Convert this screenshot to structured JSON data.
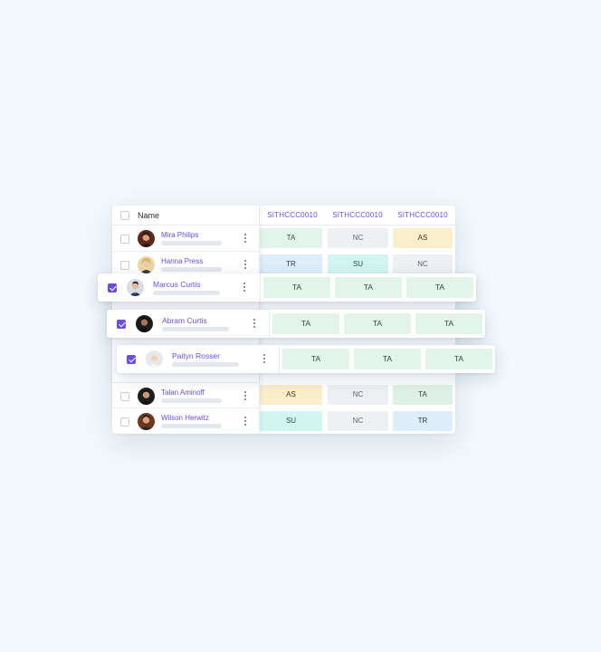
{
  "table": {
    "header": {
      "name_label": "Name",
      "columns": [
        "SITHCCC0010",
        "SITHCCC0010",
        "SITHCCC0010"
      ]
    },
    "rows": [
      {
        "name": "Mira Philips",
        "checked": false,
        "cells": [
          "TA",
          "NC",
          "AS"
        ]
      },
      {
        "name": "Hanna Press",
        "checked": false,
        "cells": [
          "TR",
          "SU",
          "NC"
        ]
      },
      {
        "name": "Marcus Curtis",
        "checked": true,
        "cells": [
          "TA",
          "TA",
          "TA"
        ]
      },
      {
        "name": "Abram Curtis",
        "checked": true,
        "cells": [
          "TA",
          "TA",
          "TA"
        ]
      },
      {
        "name": "Paityn Rosser",
        "checked": true,
        "cells": [
          "TA",
          "TA",
          "TA"
        ]
      },
      {
        "name": "Talan Aminoff",
        "checked": false,
        "cells": [
          "AS",
          "NC",
          "TA"
        ]
      },
      {
        "name": "Wilson Herwitz",
        "checked": false,
        "cells": [
          "SU",
          "NC",
          "TR"
        ]
      }
    ]
  },
  "colors": {
    "accent": "#6c4ce6",
    "TA": "#e3f5ea",
    "NC": "#eef0f3",
    "AS": "#fbeecb",
    "TR": "#ddeefa",
    "SU": "#d2f5f2"
  }
}
